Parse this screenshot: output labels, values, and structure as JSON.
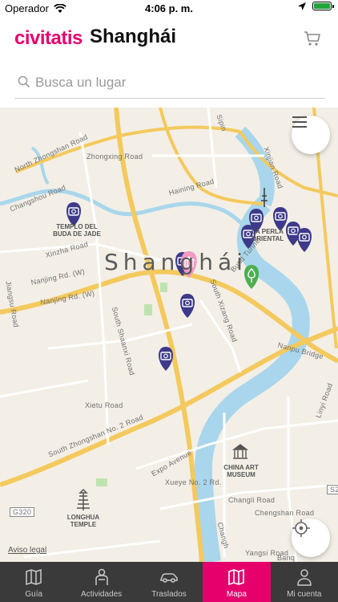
{
  "status_bar": {
    "carrier": "Operador",
    "time": "4:06 p. m."
  },
  "header": {
    "brand": "civitatis",
    "city": "Shanghái"
  },
  "search": {
    "placeholder": "Busca un lugar"
  },
  "map": {
    "city_label": "Shanghái",
    "roads": [
      "North Zhongshan Road",
      "Zhongxing Road",
      "Haining Road",
      "Changshou Road",
      "Xinzha Road",
      "Nanjing Rd. (W)",
      "Nanjing Rd. (W)",
      "South Xizang Road",
      "South Shaanxi Road",
      "Xietu Road",
      "South Zhongshan No. 2 Road",
      "Expo Avenue",
      "Xueye No. 2 Rd.",
      "Changli Road",
      "Chengshan Road",
      "Nanpu Bridge",
      "Linyi Road",
      "Yangsi Road",
      "Xinjian Road",
      "Bund Tunnel",
      "Jiangsu Road",
      "G320",
      "S2",
      "Sipin",
      "Changh",
      "Banq"
    ],
    "pois": [
      {
        "name": "TEMPLO DEL BUDA DE JADE"
      },
      {
        "name": "LA PERLA ORIENTAL",
        "display": "LA PERLA ORIENTAL"
      },
      {
        "name": "CHINA ART MUSEUM"
      },
      {
        "name": "LONGHUA TEMPLE"
      }
    ],
    "legal": "Aviso legal"
  },
  "tabs": [
    {
      "label": "Guía",
      "icon": "map-book-icon",
      "active": false
    },
    {
      "label": "Actividades",
      "icon": "guide-person-icon",
      "active": false
    },
    {
      "label": "Traslados",
      "icon": "car-icon",
      "active": false
    },
    {
      "label": "Mapa",
      "icon": "map-icon",
      "active": true
    },
    {
      "label": "Mi cuenta",
      "icon": "user-icon",
      "active": false
    }
  ],
  "colors": {
    "brand": "#e5006b",
    "pin": "#3d3a8a",
    "park": "#4caf50",
    "water": "#a5d4ea",
    "tabbar": "#3a3a3a"
  }
}
